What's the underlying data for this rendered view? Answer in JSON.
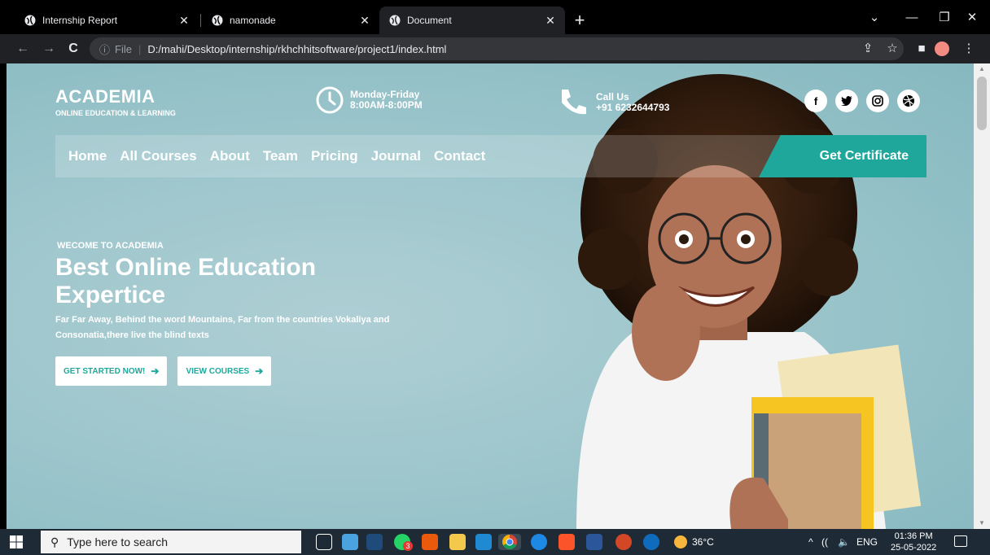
{
  "browser": {
    "tabs": [
      {
        "title": "Internship Report",
        "active": false
      },
      {
        "title": "namonade",
        "active": false
      },
      {
        "title": "Document",
        "active": true
      }
    ],
    "new_tab_label": "+",
    "address": {
      "scheme": "File",
      "path": "D:/mahi/Desktop/internship/rkhchhitsoftware/project1/index.html"
    }
  },
  "site": {
    "brand": {
      "name": "ACADEMIA",
      "tagline": "ONLINE EDUCATION & LEARNING"
    },
    "hours": {
      "line1": "Monday-Friday",
      "line2": "8:00AM-8:00PM"
    },
    "call": {
      "line1": "Call Us",
      "line2": "+91 6232644793"
    },
    "socials": [
      {
        "icon": "facebook-icon",
        "glyph": "f"
      },
      {
        "icon": "twitter-icon",
        "glyph": "🐦"
      },
      {
        "icon": "instagram-icon",
        "glyph": "◎"
      },
      {
        "icon": "dribbble-icon",
        "glyph": "✲"
      }
    ],
    "nav": [
      "Home",
      "All Courses",
      "About",
      "Team",
      "Pricing",
      "Journal",
      "Contact"
    ],
    "cta": "Get Certificate",
    "hero": {
      "kicker": "WECOME TO ACADEMIA",
      "title": "Best Online Education Expertice",
      "text": "Far Far Away, Behind the word Mountains, Far from the countries Vokaliya and Consonatia,there live the blind texts",
      "btn_primary": "GET STARTED NOW!",
      "btn_secondary": "VIEW COURSES"
    },
    "accent_color": "#20a79c"
  },
  "taskbar": {
    "search_placeholder": "Type here to search",
    "weather": "36°C",
    "language": "ENG",
    "time": "01:36 PM",
    "date": "25-05-2022",
    "whatsapp_badge": "3"
  }
}
